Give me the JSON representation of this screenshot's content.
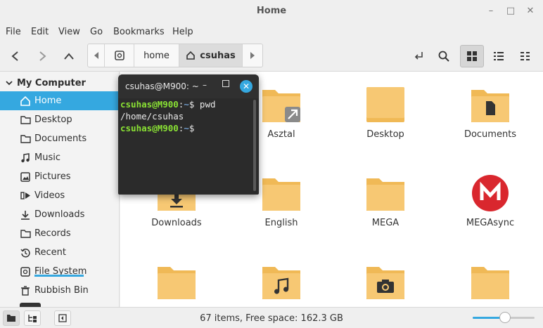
{
  "window": {
    "title": "Home"
  },
  "menu": [
    "File",
    "Edit",
    "View",
    "Go",
    "Bookmarks",
    "Help"
  ],
  "pathbar": {
    "crumbs": [
      "home",
      "csuhas"
    ],
    "active_index": 1
  },
  "sidebar": {
    "header": "My Computer",
    "items": [
      {
        "label": "Home",
        "icon": "home-icon",
        "active": true
      },
      {
        "label": "Desktop",
        "icon": "folder-icon"
      },
      {
        "label": "Documents",
        "icon": "document-icon"
      },
      {
        "label": "Music",
        "icon": "music-icon"
      },
      {
        "label": "Pictures",
        "icon": "picture-icon"
      },
      {
        "label": "Videos",
        "icon": "video-icon"
      },
      {
        "label": "Downloads",
        "icon": "download-icon"
      },
      {
        "label": "Records",
        "icon": "folder-icon"
      },
      {
        "label": "Recent",
        "icon": "recent-icon"
      },
      {
        "label": "File System",
        "icon": "drive-icon"
      },
      {
        "label": "Rubbish Bin",
        "icon": "trash-icon"
      }
    ]
  },
  "files": [
    {
      "label": "",
      "kind": "folder"
    },
    {
      "label": "Asztal",
      "kind": "folder-link"
    },
    {
      "label": "Desktop",
      "kind": "folder"
    },
    {
      "label": "Documents",
      "kind": "folder-docs"
    },
    {
      "label": "Downloads",
      "kind": "folder-download"
    },
    {
      "label": "English",
      "kind": "folder"
    },
    {
      "label": "MEGA",
      "kind": "folder"
    },
    {
      "label": "MEGAsync",
      "kind": "mega"
    },
    {
      "label": "",
      "kind": "folder"
    },
    {
      "label": "",
      "kind": "folder-music"
    },
    {
      "label": "",
      "kind": "folder-camera"
    },
    {
      "label": "",
      "kind": "folder"
    }
  ],
  "terminal": {
    "title": "csuhas@M900: ~",
    "lines": [
      {
        "prompt": "csuhas@M900",
        "path": "~",
        "cmd": " pwd"
      },
      {
        "output": "/home/csuhas"
      },
      {
        "prompt": "csuhas@M900",
        "path": "~",
        "cmd": ""
      }
    ]
  },
  "status": {
    "text": "67 items, Free space: 162.3 GB",
    "zoom_fraction": 0.52
  },
  "colors": {
    "accent": "#35a8e0",
    "folder": "#f7c873",
    "folder_dark": "#f0b956",
    "mega": "#d9272e",
    "terminal_bg": "#2b2b2b"
  }
}
